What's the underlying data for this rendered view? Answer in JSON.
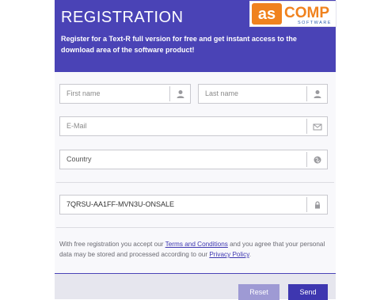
{
  "header": {
    "title": "REGISTRATION",
    "intro": "Register for a Text-R full version for free and get instant access to the download area of the software product!"
  },
  "logo": {
    "brand_left": "as",
    "brand_right": "comp",
    "tagline": "SOFTWARE",
    "colors": {
      "orange": "#f0821e",
      "blue": "#2b5fae"
    }
  },
  "form": {
    "first_name": {
      "placeholder": "First name",
      "icon": "person-icon"
    },
    "last_name": {
      "placeholder": "Last name",
      "icon": "person-icon"
    },
    "email": {
      "placeholder": "E-Mail",
      "icon": "envelope-icon"
    },
    "country": {
      "value": "Country",
      "icon": "globe-icon"
    },
    "license_key": {
      "value": "7QRSU-AA1FF-MVN3U-ONSALE",
      "icon": "lock-icon"
    }
  },
  "legal": {
    "part1": "With free registration you accept our ",
    "terms_link": "Terms and Conditions",
    "part2": " and you agree that your personal data may be stored and processed according to our ",
    "privacy_link": "Privacy Policy",
    "part3": "."
  },
  "buttons": {
    "reset": "Reset",
    "send": "Send"
  },
  "colors": {
    "header_bg": "#4a43b6",
    "send_bg": "#3e37b0",
    "reset_bg": "#9e9ad4",
    "link": "#3d36b0"
  }
}
